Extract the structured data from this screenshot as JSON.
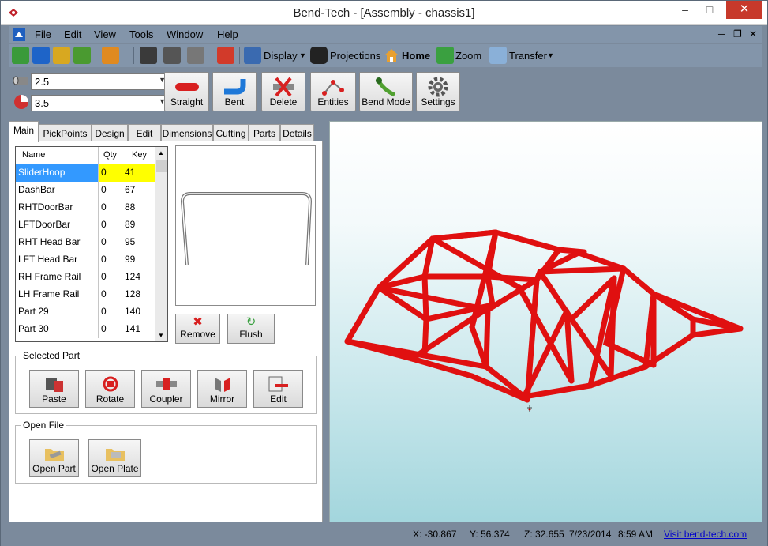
{
  "window": {
    "title": "Bend-Tech - [Assembly - chassis1]"
  },
  "menu": [
    "File",
    "Edit",
    "View",
    "Tools",
    "Window",
    "Help"
  ],
  "toolbar": {
    "display_label": "Display",
    "projections_label": "Projections",
    "home_label": "Home",
    "zoom_label": "Zoom",
    "transfer_label": "Transfer"
  },
  "combos": {
    "diameter": "2.5",
    "radius": "3.5"
  },
  "commands": [
    "Straight",
    "Bent",
    "Delete",
    "Entities",
    "Bend Mode",
    "Settings"
  ],
  "tabs": [
    "Main",
    "PickPoints",
    "Design",
    "Edit",
    "Dimensions",
    "Cutting",
    "Parts",
    "Details"
  ],
  "grid": {
    "headers": [
      "Name",
      "Qty",
      "Key"
    ],
    "rows": [
      [
        "SliderHoop",
        "0",
        "41"
      ],
      [
        "DashBar",
        "0",
        "67"
      ],
      [
        "RHTDoorBar",
        "0",
        "88"
      ],
      [
        "LFTDoorBar",
        "0",
        "89"
      ],
      [
        "RHT Head Bar",
        "0",
        "95"
      ],
      [
        "LFT Head Bar",
        "0",
        "99"
      ],
      [
        "RH Frame Rail",
        "0",
        "124"
      ],
      [
        "LH Frame Rail",
        "0",
        "128"
      ],
      [
        "Part 29",
        "0",
        "140"
      ],
      [
        "Part 30",
        "0",
        "141"
      ]
    ]
  },
  "list_actions": {
    "remove": "Remove",
    "flush": "Flush"
  },
  "selected_part": {
    "title": "Selected Part",
    "buttons": [
      "Paste",
      "Rotate",
      "Coupler",
      "Mirror",
      "Edit"
    ]
  },
  "open_file": {
    "title": "Open File",
    "buttons": [
      "Open Part",
      "Open Plate"
    ]
  },
  "status": {
    "x": "X: -30.867",
    "y": "Y: 56.374",
    "z": "Z: 32.655",
    "date": "7/23/2014",
    "time": "8:59 AM",
    "link": "Visit bend-tech.com"
  },
  "colors": {
    "frame": "#e01010",
    "selection": "#3399ff",
    "highlight": "#ffff00"
  }
}
